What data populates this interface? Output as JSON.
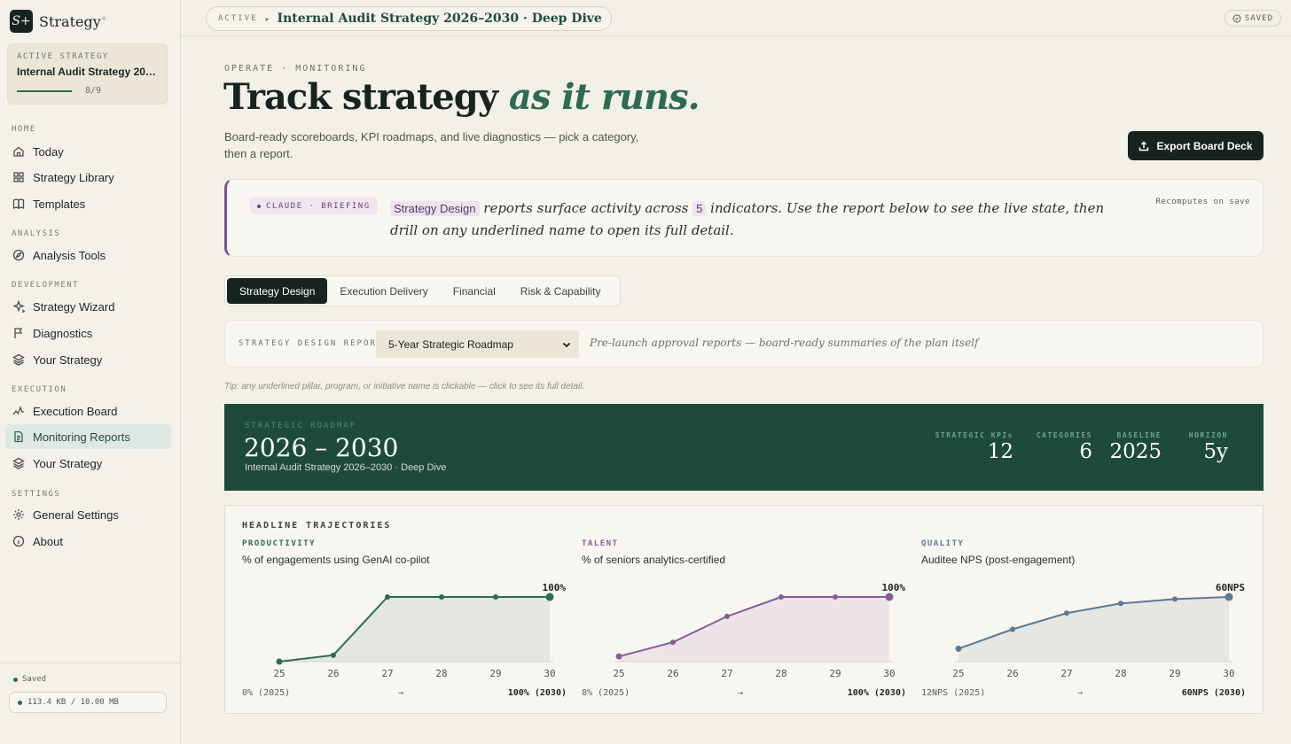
{
  "brand": {
    "logo": "S+",
    "name": "Strategy",
    "mark": "+"
  },
  "active_strategy": {
    "label": "ACTIVE STRATEGY",
    "name": "Internal Audit Strategy 2026–2030 · Deep Dive",
    "progress_text": "8/9",
    "progress": 0.889
  },
  "nav": {
    "home_label": "HOME",
    "analysis_label": "ANALYSIS",
    "development_label": "DEVELOPMENT",
    "execution_label": "EXECUTION",
    "settings_label": "SETTINGS",
    "today": "Today",
    "library": "Strategy Library",
    "templates": "Templates",
    "analysis_tools": "Analysis Tools",
    "wizard": "Strategy Wizard",
    "diagnostics": "Diagnostics",
    "your_strategy_dev": "Your Strategy",
    "execution_board": "Execution Board",
    "monitoring": "Monitoring Reports",
    "your_strategy_exec": "Your Strategy",
    "general_settings": "General Settings",
    "about": "About"
  },
  "footer": {
    "saved": "Saved",
    "storage": "113.4 KB / 10.00 MB"
  },
  "topbar": {
    "status": "ACTIVE",
    "arrow": "▸",
    "title": "Internal Audit Strategy 2026–2030 · Deep Dive",
    "saved": "SAVED"
  },
  "page": {
    "eyebrow": "OPERATE · MONITORING",
    "title_main": "Track strategy",
    "title_accent": "as it runs.",
    "subtitle": "Board-ready scoreboards, KPI roadmaps, and live diagnostics — pick a category, then a report.",
    "export_label": "Export Board Deck"
  },
  "briefing": {
    "tag": "CLAUDE · BRIEFING",
    "chip": "Strategy Design",
    "text_a": "reports surface activity across",
    "count": "5",
    "text_b": "indicators. Use the report below to see the live state, then drill on any underlined name to open its full detail.",
    "recompute": "Recomputes on save"
  },
  "tabs": [
    "Strategy Design",
    "Execution Delivery",
    "Financial",
    "Risk & Capability"
  ],
  "report": {
    "label": "STRATEGY DESIGN REPORT",
    "selected": "5-Year Strategic Roadmap",
    "description": "Pre-launch approval reports — board-ready summaries of the plan itself",
    "tip": "Tip: any underlined pillar, program, or initiative name is clickable — click to see its full detail."
  },
  "roadmap": {
    "label": "STRATEGIC ROADMAP",
    "years": "2026 – 2030",
    "subtitle": "Internal Audit Strategy 2026–2030 · Deep Dive",
    "stats": [
      {
        "k": "STRATEGIC KPIs",
        "v": "12"
      },
      {
        "k": "CATEGORIES",
        "v": "6"
      },
      {
        "k": "BASELINE",
        "v": "2025"
      },
      {
        "k": "HORIZON",
        "v": "5y"
      }
    ]
  },
  "trajectories": {
    "heading": "HEADLINE TRAJECTORIES",
    "panels": [
      {
        "category": "PRODUCTIVITY",
        "metric": "% of engagements using GenAI co-pilot",
        "color": "#2d6b52",
        "fill": "#e3e7df",
        "end_label": "100%",
        "start_text": "0% (2025)",
        "arrow": "→",
        "end_text": "100% (2030)"
      },
      {
        "category": "TALENT",
        "metric": "% of seniors analytics-certified",
        "color": "#875c99",
        "fill": "#ece4e6",
        "end_label": "100%",
        "start_text": "8% (2025)",
        "arrow": "→",
        "end_text": "100% (2030)"
      },
      {
        "category": "QUALITY",
        "metric": "Auditee NPS (post-engagement)",
        "color": "#5c7894",
        "fill": "#e6e6e2",
        "end_label": "60NPS",
        "start_text": "12NPS (2025)",
        "arrow": "→",
        "end_text": "60NPS (2030)"
      }
    ]
  },
  "chart_data": [
    {
      "type": "area",
      "title": "% of engagements using GenAI co-pilot",
      "x": [
        "25",
        "26",
        "27",
        "28",
        "29",
        "30"
      ],
      "series": [
        {
          "values": [
            0,
            10,
            100,
            100,
            100,
            100
          ]
        }
      ],
      "ylim": [
        0,
        100
      ]
    },
    {
      "type": "area",
      "title": "% of seniors analytics-certified",
      "x": [
        "25",
        "26",
        "27",
        "28",
        "29",
        "30"
      ],
      "series": [
        {
          "values": [
            8,
            30,
            70,
            100,
            100,
            100
          ]
        }
      ],
      "ylim": [
        0,
        100
      ]
    },
    {
      "type": "area",
      "title": "Auditee NPS (post-engagement)",
      "x": [
        "25",
        "26",
        "27",
        "28",
        "29",
        "30"
      ],
      "series": [
        {
          "values": [
            12,
            30,
            45,
            54,
            58,
            60
          ]
        }
      ],
      "ylim": [
        0,
        60
      ]
    }
  ]
}
